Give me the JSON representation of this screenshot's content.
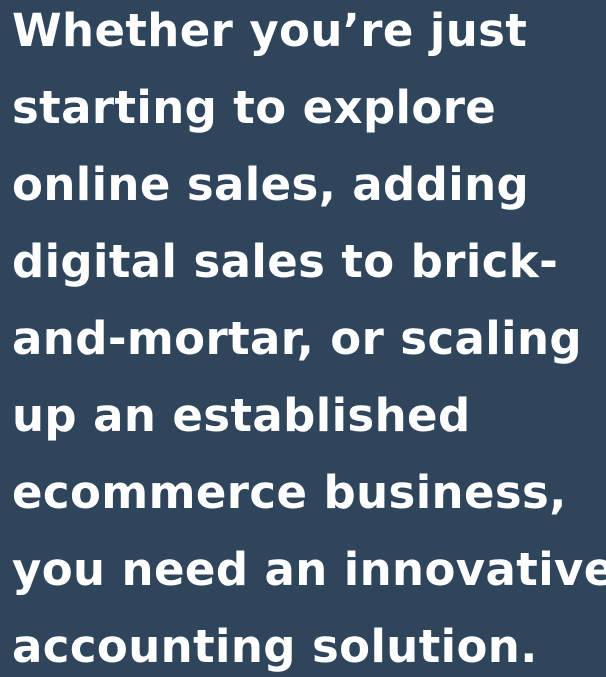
{
  "message": {
    "lines": [
      "Whether you’re just",
      "starting to explore",
      "online sales, adding",
      "digital sales to brick-",
      "and-mortar, or scaling",
      "up an established",
      "ecommerce business,",
      "you need an innovative",
      "accounting solution."
    ]
  },
  "colors": {
    "background": "#2f455c",
    "text": "#ffffff"
  }
}
